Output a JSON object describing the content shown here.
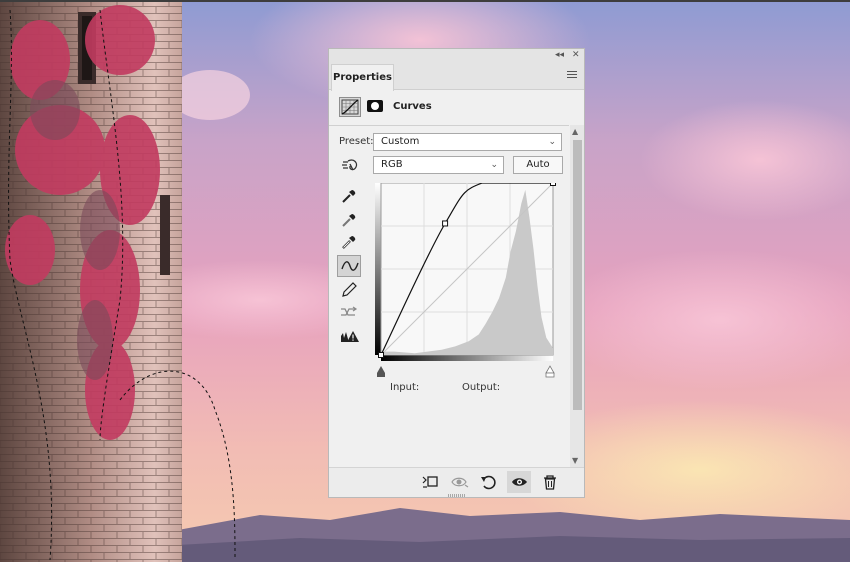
{
  "panel": {
    "collapse_icon": "double-chevron-left-icon",
    "close_icon": "close-icon",
    "tab_label": "Properties",
    "menu_icon": "panel-menu-icon"
  },
  "adjustment": {
    "icon": "curves-adjustment-icon",
    "mask_icon": "layer-mask-icon",
    "title": "Curves"
  },
  "preset": {
    "label": "Preset:",
    "value": "Custom"
  },
  "channel": {
    "value": "RGB",
    "auto_label": "Auto"
  },
  "tools": [
    "on-image-adjust-icon",
    "sample-black-point-eyedropper-icon",
    "sample-gray-point-eyedropper-icon",
    "sample-white-point-eyedropper-icon",
    "edit-points-curve-icon",
    "draw-curve-pencil-icon",
    "smooth-curve-icon",
    "clipping-warning-icon"
  ],
  "io": {
    "input_label": "Input:",
    "output_label": "Output:"
  },
  "footer": [
    "clip-to-layer-icon",
    "view-previous-state-icon",
    "reset-to-defaults-icon",
    "toggle-visibility-icon",
    "delete-adjustment-icon"
  ],
  "chart_data": {
    "type": "line",
    "xlim": [
      0,
      255
    ],
    "ylim": [
      0,
      255
    ],
    "grid": true,
    "curve_points": [
      [
        0,
        0
      ],
      [
        95,
        195
      ],
      [
        150,
        255
      ],
      [
        255,
        255
      ]
    ],
    "histogram_shape": [
      [
        0,
        0.02
      ],
      [
        20,
        0.02
      ],
      [
        50,
        0.01
      ],
      [
        90,
        0.03
      ],
      [
        110,
        0.05
      ],
      [
        130,
        0.08
      ],
      [
        145,
        0.12
      ],
      [
        155,
        0.18
      ],
      [
        165,
        0.25
      ],
      [
        175,
        0.33
      ],
      [
        185,
        0.45
      ],
      [
        192,
        0.6
      ],
      [
        200,
        0.72
      ],
      [
        208,
        0.88
      ],
      [
        214,
        0.96
      ],
      [
        220,
        0.8
      ],
      [
        226,
        0.62
      ],
      [
        232,
        0.4
      ],
      [
        238,
        0.22
      ],
      [
        245,
        0.1
      ],
      [
        255,
        0.04
      ]
    ]
  }
}
